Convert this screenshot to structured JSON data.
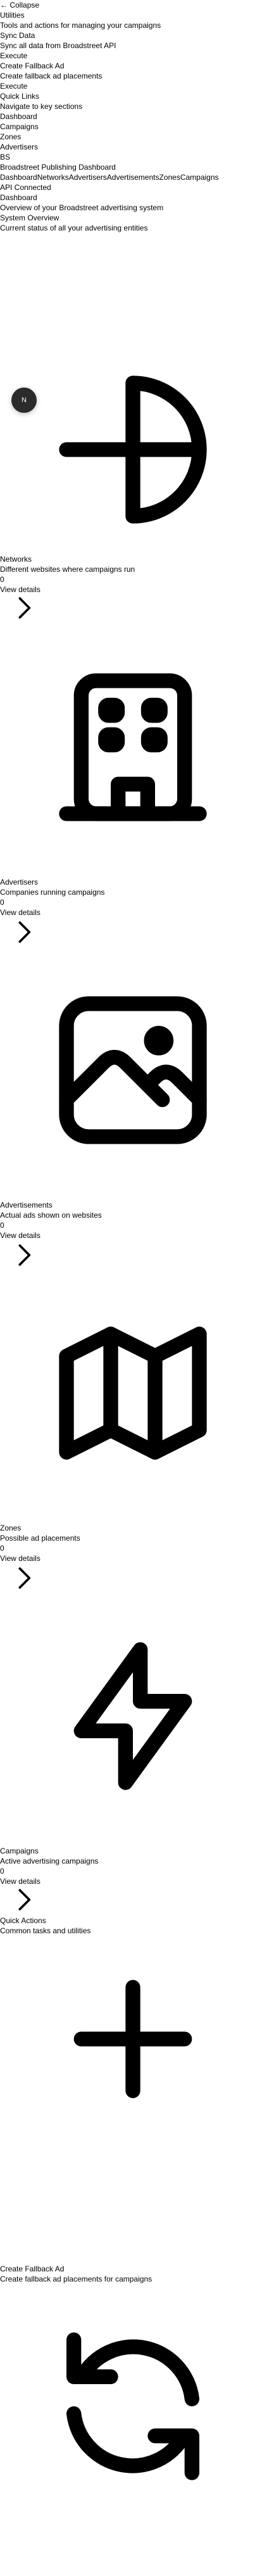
{
  "sidebar": {
    "collapse_label": "Collapse",
    "collapse_arrow": "←",
    "utilities_heading": "Utilities",
    "utilities_sub": "Tools and actions for managing your campaigns",
    "sync_title": "Sync Data",
    "sync_desc": "Sync all data from Broadstreet API",
    "sync_action": "Execute",
    "fallback_title": "Create Fallback Ad",
    "fallback_desc": "Create fallback ad placements",
    "fallback_action": "Execute",
    "quicklinks_heading": "Quick Links",
    "quicklinks_sub": "Navigate to key sections",
    "links": [
      "Dashboard",
      "Campaigns",
      "Zones",
      "Advertisers"
    ],
    "brand_initials": "BS",
    "brand_name": "Broadstreet Publishing Dashboard"
  },
  "nav": {
    "items": [
      "Dashboard",
      "Networks",
      "Advertisers",
      "Advertisements",
      "Zones",
      "Campaigns"
    ],
    "api_status": "API Connected"
  },
  "header": {
    "title": "Dashboard",
    "subtitle": "Overview of your Broadstreet advertising system"
  },
  "overview": {
    "title": "System Overview",
    "subtitle": "Current status of all your advertising entities"
  },
  "avatar": {
    "initial": "N"
  },
  "cards": [
    {
      "icon": "target-icon",
      "title": "Networks",
      "desc": "Different websites where campaigns run",
      "count": "0",
      "link": "View details"
    },
    {
      "icon": "building-icon",
      "title": "Advertisers",
      "desc": "Companies running campaigns",
      "count": "0",
      "link": "View details"
    },
    {
      "icon": "image-icon",
      "title": "Advertisements",
      "desc": "Actual ads shown on websites",
      "count": "0",
      "link": "View details"
    },
    {
      "icon": "map-icon",
      "title": "Zones",
      "desc": "Possible ad placements",
      "count": "0",
      "link": "View details"
    },
    {
      "icon": "lightning-icon",
      "title": "Campaigns",
      "desc": "Active advertising campaigns",
      "count": "0",
      "link": "View details"
    }
  ],
  "quick_actions": {
    "title": "Quick Actions",
    "subtitle": "Common tasks and utilities",
    "items": [
      {
        "icon": "plus-icon",
        "title": "Create Fallback Ad",
        "desc": "Create fallback ad placements for campaigns"
      },
      {
        "icon": "refresh-icon"
      }
    ]
  },
  "colors": {
    "text": "#000000",
    "background": "#ffffff",
    "avatar_bg": "#2b2b2b"
  }
}
